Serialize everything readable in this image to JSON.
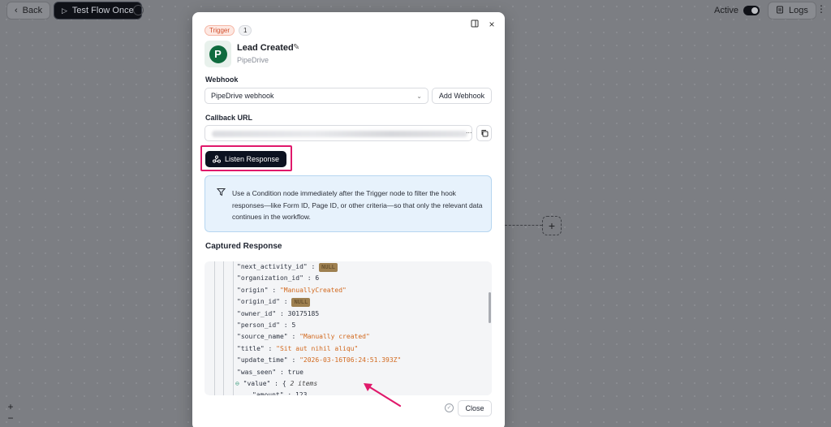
{
  "topbar": {
    "back_label": "Back",
    "test_label": "Test Flow Once",
    "active_label": "Active",
    "logs_label": "Logs"
  },
  "modal": {
    "trigger_badge": "Trigger",
    "step_number": "1",
    "node_title": "Lead Created",
    "node_app": "PipeDrive",
    "app_logo_letter": "P",
    "webhook_label": "Webhook",
    "webhook_value": "PipeDrive webhook",
    "add_webhook_label": "Add Webhook",
    "callback_label": "Callback URL",
    "url_ellipsis": "...",
    "listen_label": "Listen Response",
    "info_text": "Use a Condition node immediately after the Trigger node to filter the hook responses—like Form ID, Page ID, or other criteria—so that only the relevant data continues in the workflow.",
    "captured_title": "Captured Response",
    "close_label": "Close"
  },
  "response_lines": [
    {
      "key": "\"next_activity_id\"",
      "sep": " : ",
      "null": "NULL"
    },
    {
      "key": "\"organization_id\"",
      "sep": " : ",
      "num": "6"
    },
    {
      "key": "\"origin\"",
      "sep": " : ",
      "str": "\"ManuallyCreated\""
    },
    {
      "key": "\"origin_id\"",
      "sep": " : ",
      "null": "NULL"
    },
    {
      "key": "\"owner_id\"",
      "sep": " : ",
      "num": "30175185"
    },
    {
      "key": "\"person_id\"",
      "sep": " : ",
      "num": "5"
    },
    {
      "key": "\"source_name\"",
      "sep": " : ",
      "str": "\"Manually created\""
    },
    {
      "key": "\"title\"",
      "sep": " : ",
      "str": "\"Sit aut nihil aliqu\""
    },
    {
      "key": "\"update_time\"",
      "sep": " : ",
      "str": "\"2026-03-16T06:24:51.393Z\""
    },
    {
      "key": "\"was_seen\"",
      "sep": " : ",
      "num": "true"
    },
    {
      "fold": "⊖",
      "key": "\"value\"",
      "sep": " : ",
      "brace": "{",
      "count": "2 items"
    },
    {
      "key": "\"amount\"",
      "sep": " : ",
      "num": "123",
      "indent": true
    }
  ],
  "colors": {
    "accent_pink": "#e0196b",
    "listen_bg": "#0c1220",
    "info_bg": "#e7f2fc",
    "string_orange": "#d2691e"
  }
}
